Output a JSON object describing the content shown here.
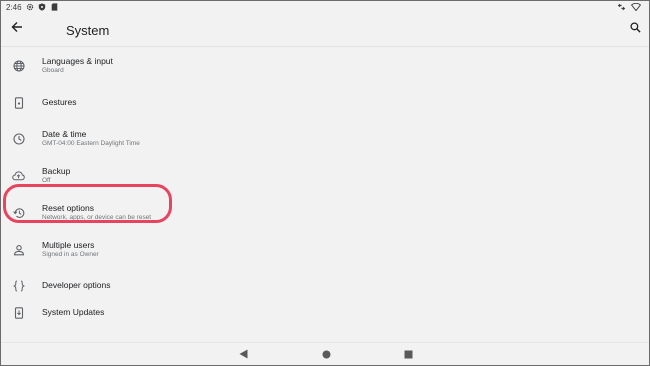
{
  "status_bar": {
    "time": "2:46",
    "icons": [
      "gear-icon",
      "shield-icon",
      "sd-card-icon"
    ],
    "right_icons": [
      "data-arrows-icon",
      "wifi-icon"
    ]
  },
  "app_bar": {
    "title": "System",
    "back_icon": "arrow-back-icon",
    "search_icon": "search-icon"
  },
  "settings": [
    {
      "icon": "globe-icon",
      "title": "Languages & input",
      "subtitle": "Gboard"
    },
    {
      "icon": "gestures-icon",
      "title": "Gestures",
      "subtitle": ""
    },
    {
      "icon": "clock-icon",
      "title": "Date & time",
      "subtitle": "GMT-04:00 Eastern Daylight Time"
    },
    {
      "icon": "cloud-upload-icon",
      "title": "Backup",
      "subtitle": "Off"
    },
    {
      "icon": "history-icon",
      "title": "Reset options",
      "subtitle": "Network, apps, or device can be reset"
    },
    {
      "icon": "person-icon",
      "title": "Multiple users",
      "subtitle": "Signed in as Owner"
    },
    {
      "icon": "braces-icon",
      "title": "Developer options",
      "subtitle": ""
    },
    {
      "icon": "system-update-icon",
      "title": "System Updates",
      "subtitle": ""
    }
  ],
  "nav_bar": [
    "back-triangle-icon",
    "home-circle-icon",
    "recents-square-icon"
  ],
  "colors": {
    "background": "#f2f2f2",
    "highlight": "#e8435f",
    "text_primary": "#202124",
    "text_secondary": "#70757a",
    "icon": "#5f6368"
  }
}
